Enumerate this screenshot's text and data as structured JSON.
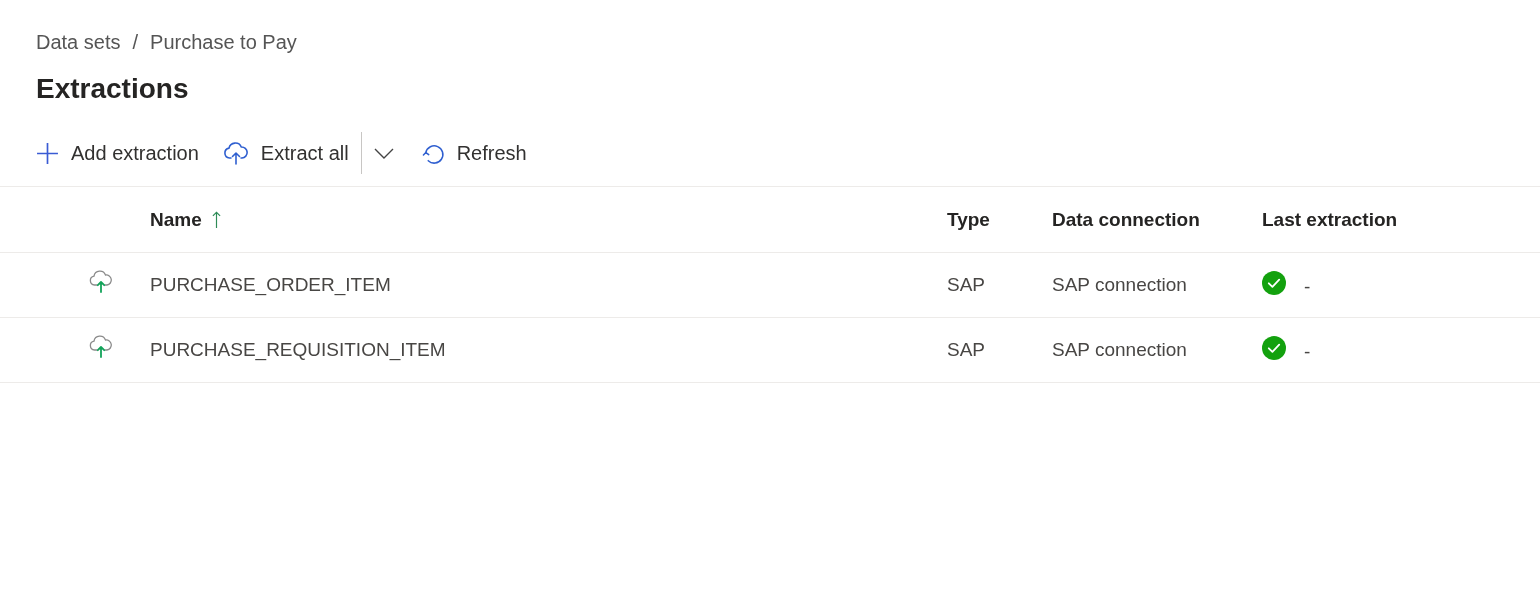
{
  "breadcrumb": {
    "items": [
      {
        "label": "Data sets"
      },
      {
        "label": "Purchase to Pay"
      }
    ],
    "separator": "/"
  },
  "title": "Extractions",
  "toolbar": [
    {
      "kind": "add",
      "label": "Add extraction",
      "has_menu": false
    },
    {
      "kind": "extract",
      "label": "Extract all",
      "has_menu": true
    },
    {
      "kind": "refresh",
      "label": "Refresh",
      "has_menu": false
    }
  ],
  "table": {
    "columns": [
      {
        "label": "Name",
        "sorted": true
      },
      {
        "label": "Type",
        "sorted": false
      },
      {
        "label": "Data connection",
        "sorted": false
      },
      {
        "label": "Last extraction",
        "sorted": false
      }
    ],
    "rows": [
      {
        "name": "PURCHASE_ORDER_ITEM",
        "type": "SAP",
        "connection": "SAP connection",
        "succeeded": true,
        "last_extraction": "-"
      },
      {
        "name": "PURCHASE_REQUISITION_ITEM",
        "type": "SAP",
        "connection": "SAP connection",
        "succeeded": true,
        "last_extraction": "-"
      }
    ]
  }
}
